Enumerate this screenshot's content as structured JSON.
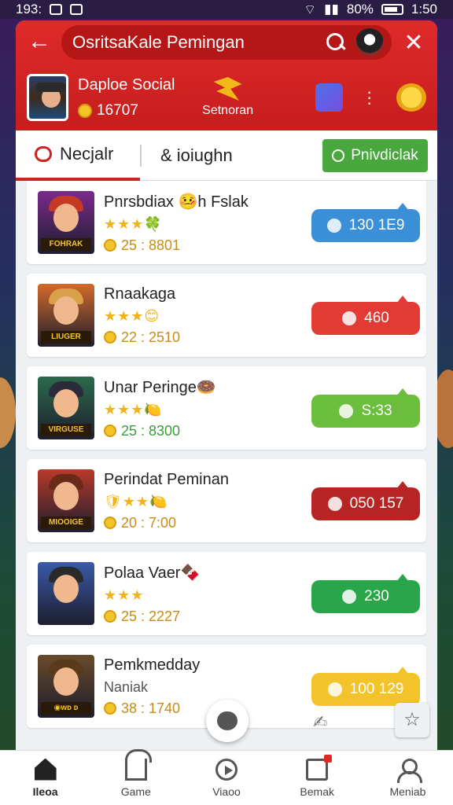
{
  "status_bar": {
    "time_left": "193:",
    "battery": "80%",
    "clock": "1:50"
  },
  "header": {
    "title": "OsritsaKale Pemingan",
    "user_name": "Daploe Social",
    "user_coins": "16707",
    "action_label": "Setnoran"
  },
  "tabs": {
    "tab1": "Necjalr",
    "tab2": "& ioiughn",
    "button": "Pnivdiclak"
  },
  "games": [
    {
      "name": "Pnrsbdiax 🤒h Fslak",
      "stars": "★★★🍀",
      "meta": "25 : 8801",
      "badge": "130 1E9",
      "plate": "FOHRAK",
      "meta_color": "orange",
      "badge_color": "#3b8fd6",
      "thumb_bg": "#7a2b8c",
      "hair": "#c63a25"
    },
    {
      "name": "Rnaakaga",
      "stars": "★★★😊",
      "meta": "22 : 2510",
      "badge": "460",
      "plate": "LIUGER",
      "meta_color": "orange",
      "badge_color": "#e33a36",
      "thumb_bg": "#d46a2a",
      "hair": "#d9a24a"
    },
    {
      "name": "Unar Peringe🍩",
      "stars": "★★★🍋",
      "meta": "25 : 8300",
      "badge": "S:33",
      "plate": "VIRGUSE",
      "meta_color": "green",
      "badge_color": "#6bbd3d",
      "thumb_bg": "#2b6a4a",
      "hair": "#2a2a3a"
    },
    {
      "name": "Perindat Peminan",
      "stars": "🛡★★🍋",
      "meta": "20 : 7:00",
      "badge": "050 157",
      "plate": "MIOOIGE",
      "meta_color": "orange",
      "badge_color": "#b82424",
      "thumb_bg": "#b83a2a",
      "hair": "#6a2a1a"
    },
    {
      "name": "Polaa Vaer🍫",
      "stars": "★★★",
      "meta": "25 : 2227",
      "badge": "230",
      "plate": "",
      "meta_color": "orange",
      "badge_color": "#2aa64a",
      "thumb_bg": "#3a5aa8",
      "hair": "#2a2a2a"
    },
    {
      "name": "Pemkmedday",
      "stars": "Naniak",
      "meta": "38 : 1740",
      "badge": "100 129",
      "plate": "◉ᴡᴅ ᴅ",
      "meta_color": "orange",
      "badge_color": "#f2c42a",
      "thumb_bg": "#6a4a2a",
      "hair": "#5a3a1a"
    }
  ],
  "bottom_nav": [
    {
      "label": "Ileoa",
      "icon": "home-icon"
    },
    {
      "label": "Game",
      "icon": "game-icon"
    },
    {
      "label": "Viaoo",
      "icon": "video-icon"
    },
    {
      "label": "Bemak",
      "icon": "news-icon"
    },
    {
      "label": "Meniab",
      "icon": "user-icon"
    }
  ]
}
